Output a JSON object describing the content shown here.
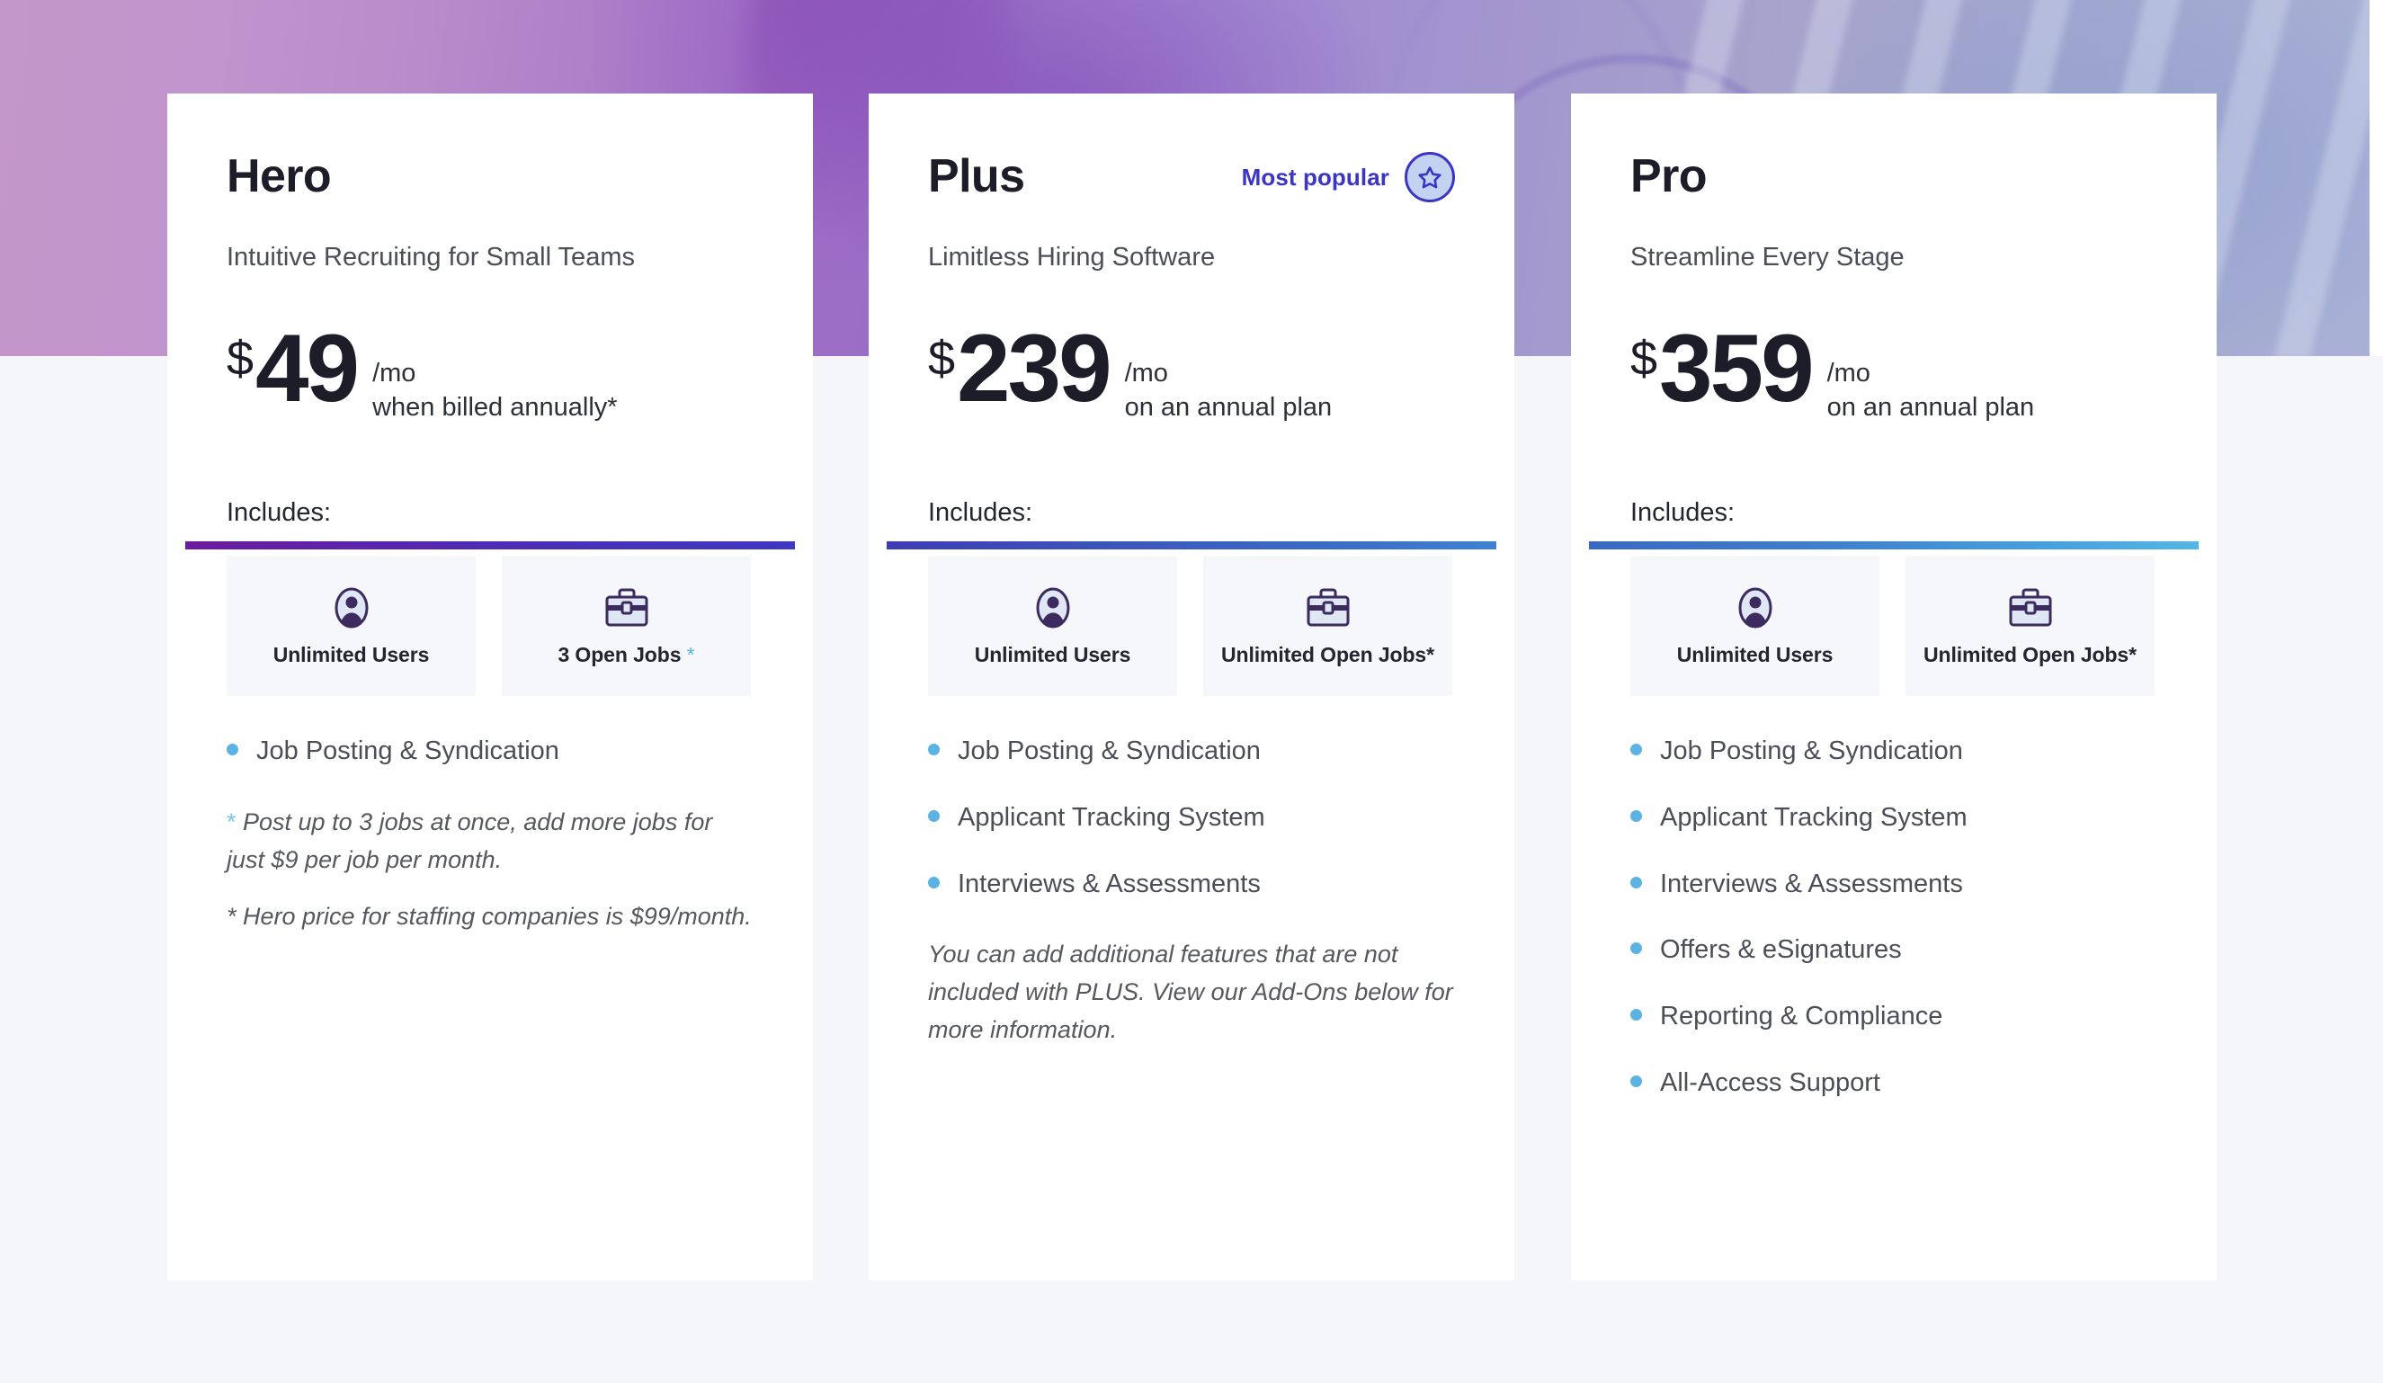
{
  "page": {
    "background_color": "#f4f6f9",
    "hero_band_colors": [
      "#c497c9",
      "#9a6ec6",
      "#a294cf",
      "#aab2d6"
    ]
  },
  "accent_colors": {
    "bullet_blue": "#5bb3e4",
    "badge_indigo": "#3b35c4",
    "badge_fill": "#c4d2f2",
    "icon_purple": "#3d2a5e"
  },
  "plans": [
    {
      "id": "hero",
      "name": "Hero",
      "tagline": "Intuitive Recruiting for Small Teams",
      "currency": "$",
      "amount": "49",
      "per": "/mo",
      "billing_note": "when billed annually*",
      "popular": null,
      "divider_gradient": [
        "#6c1ba0",
        "#4038c0"
      ],
      "includes_label": "Includes:",
      "feature_boxes": [
        {
          "icon": "user-icon",
          "label": "Unlimited Users",
          "star": ""
        },
        {
          "icon": "briefcase-icon",
          "label": "3 Open Jobs",
          "star": " *"
        }
      ],
      "bullets": [
        "Job Posting & Syndication"
      ],
      "notes": [
        {
          "star": "*",
          "star_color": "blue",
          "text": " Post up to 3 jobs at once, add more jobs for just $9 per job per month."
        },
        {
          "star": "*",
          "star_color": "gray",
          "text": " Hero price for staffing companies is $99/month."
        }
      ]
    },
    {
      "id": "plus",
      "name": "Plus",
      "tagline": "Limitless Hiring Software",
      "currency": "$",
      "amount": "239",
      "per": "/mo",
      "billing_note": "on an annual plan",
      "popular": {
        "label": "Most popular",
        "icon": "star-badge-icon"
      },
      "divider_gradient": [
        "#3f3cb5",
        "#3f81d1"
      ],
      "includes_label": "Includes:",
      "feature_boxes": [
        {
          "icon": "user-icon",
          "label": "Unlimited Users",
          "star": ""
        },
        {
          "icon": "briefcase-icon",
          "label": "Unlimited Open Jobs*",
          "star": ""
        }
      ],
      "bullets": [
        "Job Posting & Syndication",
        "Applicant Tracking System",
        "Interviews & Assessments"
      ],
      "notes": [
        {
          "star": "",
          "star_color": "none",
          "text": "You can add additional features that are not included with PLUS. View our Add-Ons below for more information."
        }
      ]
    },
    {
      "id": "pro",
      "name": "Pro",
      "tagline": "Streamline Every Stage",
      "currency": "$",
      "amount": "359",
      "per": "/mo",
      "billing_note": "on an annual plan",
      "popular": null,
      "divider_gradient": [
        "#3a68c2",
        "#54b6e4"
      ],
      "includes_label": "Includes:",
      "feature_boxes": [
        {
          "icon": "user-icon",
          "label": "Unlimited Users",
          "star": ""
        },
        {
          "icon": "briefcase-icon",
          "label": "Unlimited Open Jobs*",
          "star": ""
        }
      ],
      "bullets": [
        "Job Posting & Syndication",
        "Applicant Tracking System",
        "Interviews & Assessments",
        "Offers & eSignatures",
        "Reporting & Compliance",
        "All-Access Support"
      ],
      "notes": []
    }
  ]
}
